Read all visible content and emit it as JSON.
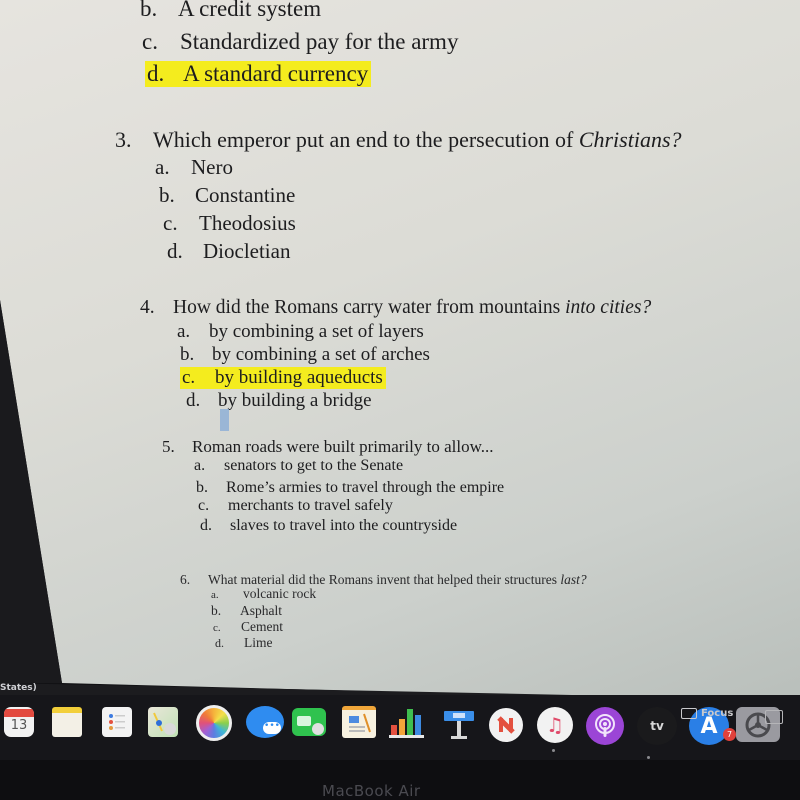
{
  "document": {
    "question2_tail": {
      "options": [
        {
          "letter": "b.",
          "text": "A credit system",
          "highlighted": false
        },
        {
          "letter": "c.",
          "text": "Standardized pay for the army",
          "highlighted": false
        },
        {
          "letter": "d.",
          "text": "A standard currency",
          "highlighted": true
        }
      ]
    },
    "questions": [
      {
        "number": "3.",
        "stem": "Which emperor put an end to the persecution of ",
        "stem_italic": "Christians?",
        "options": [
          {
            "letter": "a.",
            "text": "Nero",
            "highlighted": false
          },
          {
            "letter": "b.",
            "text": "Constantine",
            "highlighted": false
          },
          {
            "letter": "c.",
            "text": "Theodosius",
            "highlighted": false
          },
          {
            "letter": "d.",
            "text": "Diocletian",
            "highlighted": false
          }
        ]
      },
      {
        "number": "4.",
        "stem": "How did the Romans carry water from mountains ",
        "stem_italic": "into cities?",
        "options": [
          {
            "letter": "a.",
            "text": "by combining a set of layers",
            "highlighted": false
          },
          {
            "letter": "b.",
            "text": "by combining a set of arches",
            "highlighted": false
          },
          {
            "letter": "c.",
            "text": "by building aqueducts",
            "highlighted": true
          },
          {
            "letter": "d.",
            "text": "by building a bridge",
            "highlighted": false
          }
        ]
      },
      {
        "number": "5.",
        "stem": "Roman roads were built primarily to allow...",
        "stem_italic": "",
        "options": [
          {
            "letter": "a.",
            "text": "senators to get to the Senate",
            "highlighted": false
          },
          {
            "letter": "b.",
            "text": "Rome’s armies to travel through the empire",
            "highlighted": false
          },
          {
            "letter": "c.",
            "text": "merchants to travel safely",
            "highlighted": false
          },
          {
            "letter": "d.",
            "text": "slaves to travel into the countryside",
            "highlighted": false
          }
        ]
      },
      {
        "number": "6.",
        "stem": "What material did the Romans invent that helped their structures ",
        "stem_italic": "last?",
        "options": [
          {
            "letter": "a.",
            "text": "volcanic rock",
            "highlighted": false
          },
          {
            "letter": "b.",
            "text": "Asphalt",
            "highlighted": false
          },
          {
            "letter": "c.",
            "text": "Cement",
            "highlighted": false
          },
          {
            "letter": "d.",
            "text": "Lime",
            "highlighted": false
          }
        ]
      }
    ],
    "highlight_color": "#f4ec1e"
  },
  "status_strip": {
    "left_text": "States)",
    "focus_label": "Focus"
  },
  "dock": {
    "calendar_day": "13",
    "app_store_badge": "7",
    "tv_label": "tv",
    "items": [
      {
        "name": "calendar",
        "color": "#f2f2f2"
      },
      {
        "name": "notes",
        "color": "#f5ecb0"
      },
      {
        "name": "reminders",
        "color": "#f3f3f3"
      },
      {
        "name": "maps",
        "color": "#cfe6c8"
      },
      {
        "name": "photos",
        "color": "#f0f0f0"
      },
      {
        "name": "messages",
        "color": "#2f8cf0"
      },
      {
        "name": "facetime",
        "color": "#2fc24e"
      },
      {
        "name": "pages",
        "color": "#f0a63a"
      },
      {
        "name": "numbers",
        "color": "#e8e8e8"
      },
      {
        "name": "keynote",
        "color": "#3a8ee8"
      },
      {
        "name": "news",
        "color": "#f2f2f2"
      },
      {
        "name": "music",
        "color": "#f2f2f2"
      },
      {
        "name": "podcasts",
        "color": "#9b45d6"
      },
      {
        "name": "apple-tv",
        "color": "#1a1a1c"
      },
      {
        "name": "app-store",
        "color": "#2a7fe6"
      },
      {
        "name": "system-preferences",
        "color": "#8e8e93"
      }
    ]
  },
  "device_label": "MacBook Air"
}
